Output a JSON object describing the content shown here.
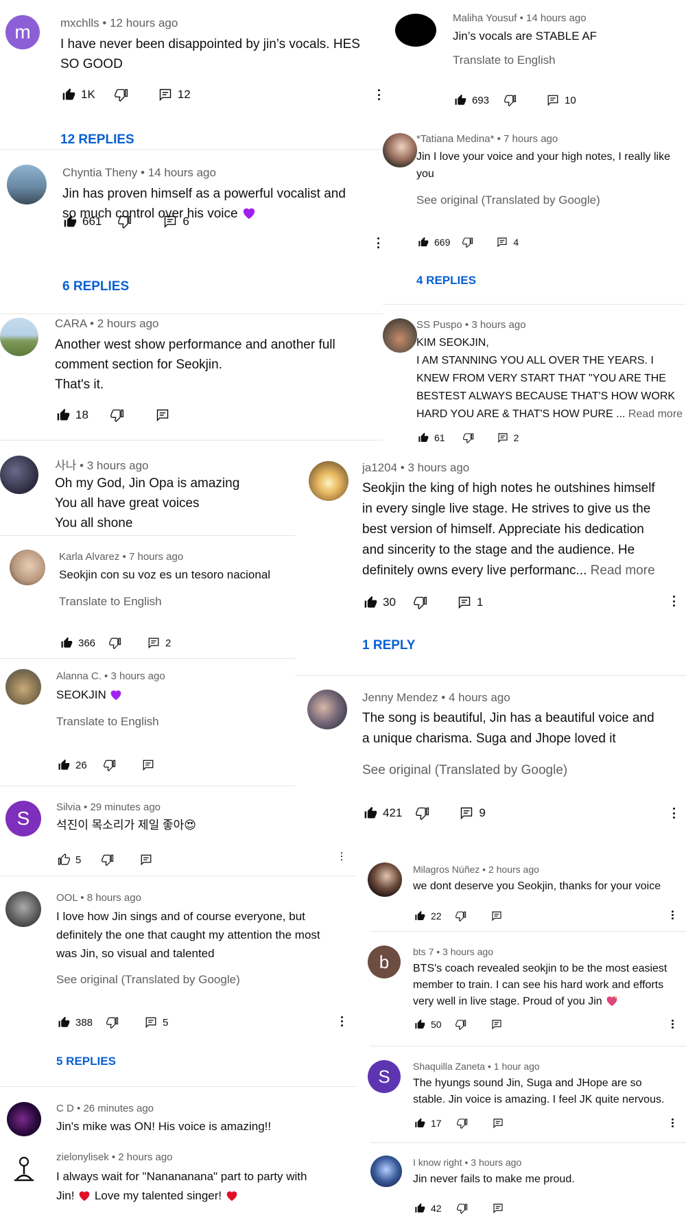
{
  "comments": [
    {
      "id": "c1",
      "author": "mxchlls",
      "time": "12 hours ago",
      "lines": [
        "I have never been disappointed by jin’s vocals. HES",
        "SO GOOD"
      ],
      "likes": "1K",
      "replies_count": "12",
      "replies_label": "12 REPLIES",
      "avatar_letter": "m",
      "avatar_color": "#8c5fd6"
    },
    {
      "id": "c2",
      "author": "Chyntia Theny",
      "time": "14 hours ago",
      "lines": [
        "Jin has proven himself as a powerful vocalist and",
        "so much control over his voice"
      ],
      "likes": "661",
      "replies_count": "6",
      "replies_label": "6 REPLIES",
      "avatar_color": "#4f6a80"
    },
    {
      "id": "c3",
      "author": "CARA",
      "time": "2 hours ago",
      "lines": [
        "Another west show performance and another full",
        "comment section for Seokjin.",
        "That's it."
      ],
      "likes": "18",
      "avatar_color": "#8aa27a"
    },
    {
      "id": "c4",
      "author": "사나",
      "time": "3 hours ago",
      "lines": [
        "Oh my God, Jin Opa is amazing",
        "You all have great voices",
        "You all shone"
      ],
      "avatar_color": "#2c2a3e"
    },
    {
      "id": "c5",
      "author": "Karla Alvarez",
      "time": "7 hours ago",
      "lines": [
        "Seokjin con su voz es un tesoro nacional"
      ],
      "translate": "Translate to English",
      "likes": "366",
      "replies_count": "2",
      "avatar_color": "#b9997f"
    },
    {
      "id": "c6",
      "author": "Alanna C.",
      "time": "3 hours ago",
      "lines": [
        "SEOKJIN"
      ],
      "translate": "Translate to English",
      "likes": "26",
      "avatar_color": "#7a6a4a"
    },
    {
      "id": "c7",
      "author": "Silvia",
      "time": "29 minutes ago",
      "lines": [
        "석진이 목소리가 제일 좋아😍"
      ],
      "likes": "5",
      "avatar_letter": "S",
      "avatar_color": "#7e2fbb"
    },
    {
      "id": "c8",
      "author": "OOL",
      "time": "8 hours ago",
      "lines": [
        "I love how Jin sings and of course everyone, but",
        "definitely the one that caught my attention the most",
        "was Jin, so visual and talented"
      ],
      "translate": "See original (Translated by Google)",
      "likes": "388",
      "replies_count": "5",
      "replies_label": "5 REPLIES",
      "avatar_color": "#555555"
    },
    {
      "id": "c9",
      "author": "C D",
      "time": "26 minutes ago",
      "lines": [
        "Jin's mike was ON! His voice is amazing!!"
      ],
      "avatar_color": "#1a0a2e"
    },
    {
      "id": "c10",
      "author": "zielonylisek",
      "time": "2 hours ago",
      "lines": [
        "I always wait for \"Nanananana\" part to party with",
        "Jin! ❤️ Love my talented singer! ❤️"
      ],
      "avatar_color": "#ffffff"
    },
    {
      "id": "c11",
      "author": "Maliha Yousuf",
      "time": "14 hours ago",
      "lines": [
        "Jin’s vocals are STABLE AF"
      ],
      "translate": "Translate to English",
      "likes": "693",
      "replies_count": "10",
      "avatar_color": "#000000"
    },
    {
      "id": "c12",
      "author": "*Tatiana Medina*",
      "time": "7 hours ago",
      "lines": [
        "Jin I love your voice and your high notes, I really like",
        "you"
      ],
      "translate": "See original (Translated by Google)",
      "likes": "669",
      "replies_count": "4",
      "replies_label": "4 REPLIES",
      "avatar_color": "#3c4a3a"
    },
    {
      "id": "c13",
      "author": "SS Puspo",
      "time": "3 hours ago",
      "lines": [
        "KIM SEOKJIN,",
        "I AM STANNING YOU ALL OVER THE YEARS. I",
        "KNEW FROM VERY START THAT \"YOU ARE THE",
        "BESTEST ALWAYS BECAUSE THAT'S HOW WORK",
        "HARD YOU ARE & THAT'S HOW PURE ..."
      ],
      "read_more": "Read more",
      "likes": "61",
      "replies_count": "2",
      "avatar_color": "#6b5a4a"
    },
    {
      "id": "c14",
      "author": "ja1204",
      "time": "3 hours ago",
      "lines": [
        "Seokjin the king of high notes he outshines himself",
        "in every single live stage. He strives to give us the",
        "best version of himself. Appreciate his dedication",
        "and sincerity to the stage and the audience. He",
        "definitely owns every live performanc..."
      ],
      "read_more": "Read more",
      "likes": "30",
      "replies_count": "1",
      "replies_label": "1 REPLY",
      "avatar_color": "#c9a36b"
    },
    {
      "id": "c15",
      "author": "Jenny Mendez",
      "time": "4 hours ago",
      "lines": [
        "The song is beautiful, Jin has a beautiful voice and",
        "a unique charisma. Suga and Jhope loved it"
      ],
      "translate": "See original (Translated by Google)",
      "likes": "421",
      "replies_count": "9",
      "avatar_color": "#5a5a6a"
    },
    {
      "id": "c16",
      "author": "Milagros Núñez",
      "time": "2 hours ago",
      "lines": [
        "we dont deserve you Seokjin, thanks for your voice"
      ],
      "likes": "22",
      "avatar_color": "#2a1e1e"
    },
    {
      "id": "c17",
      "author": "bts 7",
      "time": "3 hours ago",
      "lines": [
        "BTS's coach revealed seokjin to be the most easiest",
        "member to train. I can see his hard work and efforts",
        "very well in live stage. Proud of you Jin"
      ],
      "likes": "50",
      "avatar_letter": "b",
      "avatar_color": "#6d4c41"
    },
    {
      "id": "c18",
      "author": "Shaquilla Zaneta",
      "time": "1 hour ago",
      "lines": [
        "The hyungs sound Jin, Suga and JHope are so",
        "stable. Jin voice is amazing. I feel JK quite nervous."
      ],
      "likes": "17",
      "avatar_letter": "S",
      "avatar_color": "#5e35b1"
    },
    {
      "id": "c19",
      "author": "I know right",
      "time": "3 hours ago",
      "lines": [
        "Jin never fails to make me proud."
      ],
      "likes": "42",
      "avatar_color": "#3a5a9a"
    }
  ],
  "colors": {
    "link_blue": "#065fd4",
    "meta_gray": "#606060",
    "purple_heart": "#a020f0",
    "pink_heart": "#e0457b",
    "red_heart": "#e0102a"
  },
  "icons": [
    "like-icon",
    "dislike-icon",
    "reply-icon",
    "more-vert-icon",
    "purple-heart-icon",
    "sparkle-heart-icon",
    "red-heart-icon"
  ]
}
